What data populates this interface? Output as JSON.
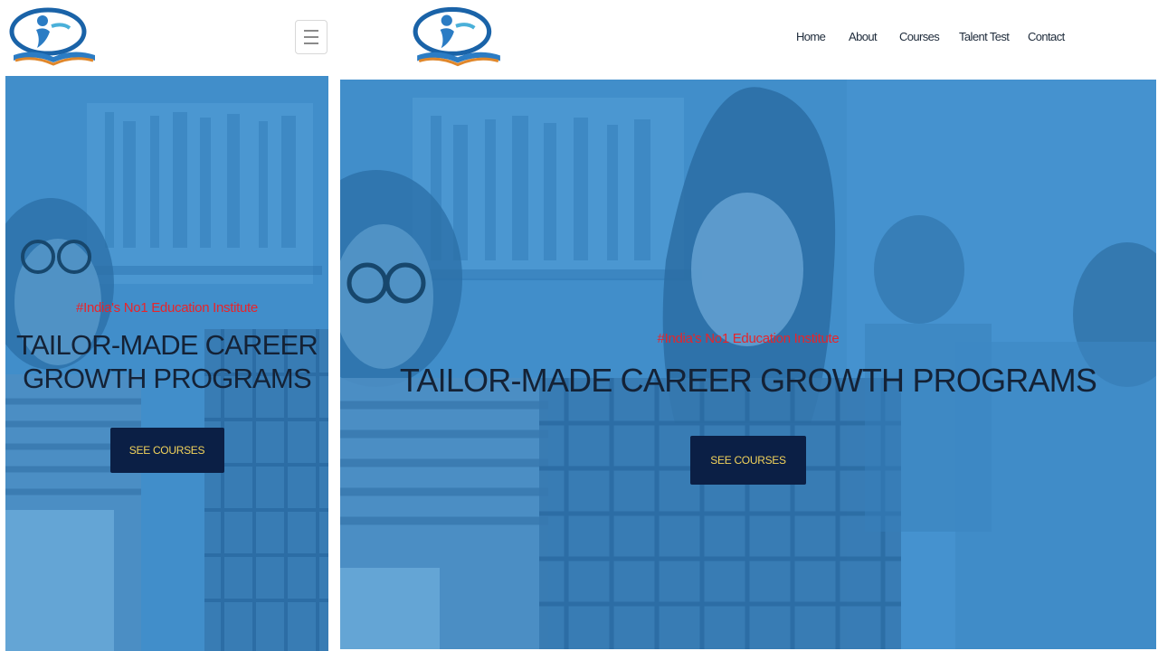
{
  "mobile": {
    "logo_icon": "education-logo-icon",
    "menu_icon": "hamburger-menu-icon",
    "hero": {
      "tagline": "#India's No1 Education Institute",
      "headline_line1": "TAILOR-MADE CAREER",
      "headline_line2": "GROWTH PROGRAMS",
      "cta_label": "SEE COURSES"
    }
  },
  "desktop": {
    "logo_icon": "education-logo-icon",
    "nav": [
      {
        "label": "Home"
      },
      {
        "label": "About"
      },
      {
        "label": "Courses"
      },
      {
        "label": "Talent Test"
      },
      {
        "label": "Contact"
      }
    ],
    "hero": {
      "tagline": "#India's No1 Education Institute",
      "headline": "TAILOR-MADE CAREER GROWTH PROGRAMS",
      "cta_label": "SEE COURSES"
    }
  },
  "colors": {
    "hero_overlay": "#2680c3",
    "tagline": "#e8242a",
    "cta_background": "#0b1f45",
    "cta_text": "#f2d35b"
  }
}
